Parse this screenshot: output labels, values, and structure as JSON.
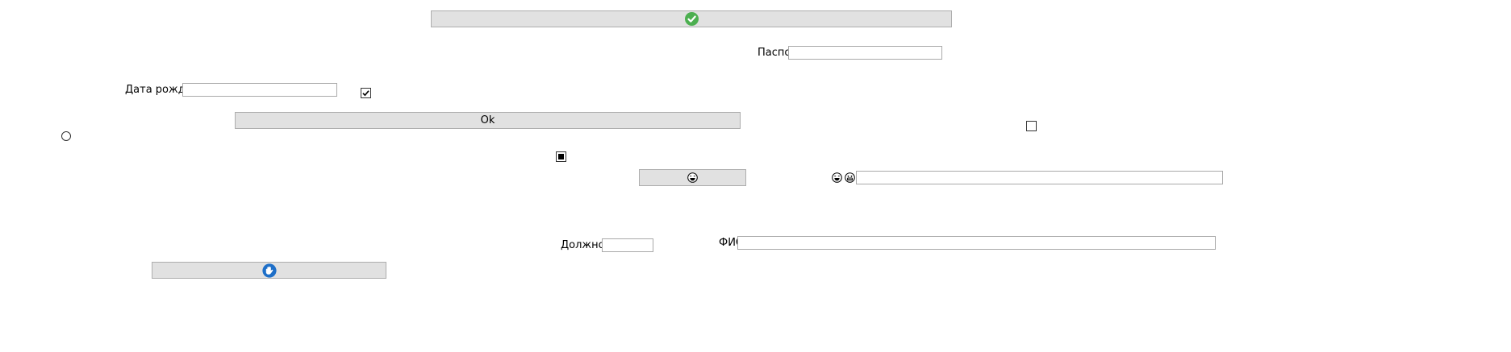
{
  "window": {
    "passport_label": "Паспорт",
    "passport_value": "",
    "birthdate_label": "Дата рождения",
    "birthdate_value": "",
    "ok_button_label": "Ok",
    "position_label": "Должность",
    "position_value": "",
    "fio_label": "ФИО",
    "fio_value": "",
    "emoji_field_value": "",
    "check_checked": true,
    "check_unchecked": false,
    "check_indeterminate": true,
    "radio_selected": false,
    "icons": {
      "top_button": "green-checkmark-icon",
      "emoji_button": "laughing-face-icon",
      "emoji_prefix_1": "laughing-face-icon",
      "emoji_prefix_2": "grinning-face-icon",
      "bottom_button": "blue-hand-icon"
    },
    "colors": {
      "button_bg": "#e1e1e1",
      "check_green": "#4caf50",
      "hand_blue": "#1e6fc8"
    }
  }
}
